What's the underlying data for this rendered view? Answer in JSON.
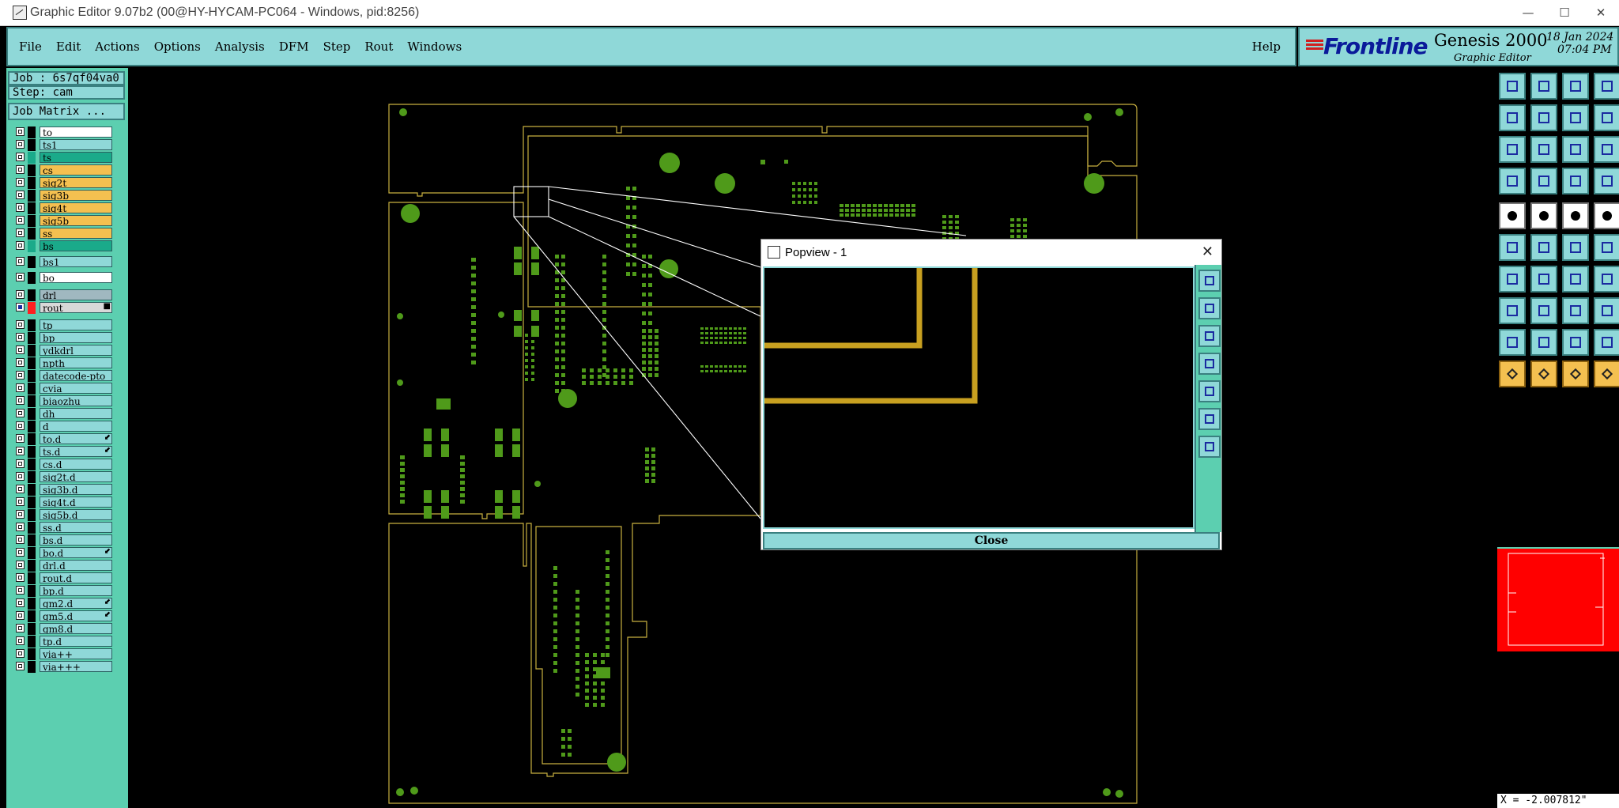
{
  "window": {
    "title": "Graphic Editor 9.07b2 (00@HY-HYCAM-PC064 - Windows, pid:8256)"
  },
  "menu": {
    "items": [
      "File",
      "Edit",
      "Actions",
      "Options",
      "Analysis",
      "DFM",
      "Step",
      "Rout",
      "Windows"
    ],
    "help": "Help"
  },
  "brand": {
    "logo": "Frontline",
    "product": "Genesis 2000",
    "subtitle": "Graphic Editor",
    "date": "18 Jan 2024",
    "time": "07:04 PM"
  },
  "job": {
    "job_label": "Job : 6s7qf04va0",
    "step_label": "Step: cam",
    "matrix_button": "Job Matrix ..."
  },
  "layers": [
    {
      "name": "to",
      "color": "#ffffff",
      "swatch": "#000000",
      "marked": false,
      "selected": false
    },
    {
      "name": "ts1",
      "color": "#8fd8d8",
      "swatch": "#000000",
      "marked": false,
      "selected": false
    },
    {
      "name": "ts",
      "color": "#1aaa8a",
      "swatch": "#1aaa8a",
      "marked": false,
      "selected": false
    },
    {
      "name": "cs",
      "color": "#f4c050",
      "swatch": "#000000",
      "marked": false,
      "selected": false
    },
    {
      "name": "sig2t",
      "color": "#f4c050",
      "swatch": "#000000",
      "marked": false,
      "selected": false
    },
    {
      "name": "sig3b",
      "color": "#f4c050",
      "swatch": "#000000",
      "marked": false,
      "selected": false
    },
    {
      "name": "sig4t",
      "color": "#f4c050",
      "swatch": "#000000",
      "marked": false,
      "selected": false
    },
    {
      "name": "sig5b",
      "color": "#f4c050",
      "swatch": "#000000",
      "marked": false,
      "selected": false
    },
    {
      "name": "ss",
      "color": "#f4c050",
      "swatch": "#000000",
      "marked": false,
      "selected": false
    },
    {
      "name": "bs",
      "color": "#1aaa8a",
      "swatch": "#1aaa8a",
      "marked": false,
      "selected": false
    },
    {
      "name": "bs1",
      "color": "#8fd8d8",
      "swatch": "#000000",
      "marked": false,
      "selected": false
    },
    {
      "name": "bo",
      "color": "#ffffff",
      "swatch": "#000000",
      "marked": false,
      "selected": false
    },
    {
      "name": "drl",
      "color": "#a0b8c0",
      "swatch": "#000000",
      "marked": false,
      "selected": false
    },
    {
      "name": "rout",
      "color": "#d8d8d8",
      "swatch": "#ff2020",
      "marked": true,
      "selected": true
    },
    {
      "name": "tp",
      "color": "#8fd8d8",
      "swatch": "#000000",
      "marked": false,
      "selected": false
    },
    {
      "name": "bp",
      "color": "#8fd8d8",
      "swatch": "#000000",
      "marked": false,
      "selected": false
    },
    {
      "name": "ydkdrl",
      "color": "#8fd8d8",
      "swatch": "#000000",
      "marked": false,
      "selected": false
    },
    {
      "name": "npth",
      "color": "#8fd8d8",
      "swatch": "#000000",
      "marked": false,
      "selected": false
    },
    {
      "name": "datecode-pto",
      "color": "#8fd8d8",
      "swatch": "#000000",
      "marked": false,
      "selected": false
    },
    {
      "name": "cvia",
      "color": "#8fd8d8",
      "swatch": "#000000",
      "marked": false,
      "selected": false
    },
    {
      "name": "biaozhu",
      "color": "#8fd8d8",
      "swatch": "#000000",
      "marked": false,
      "selected": false
    },
    {
      "name": "dh",
      "color": "#8fd8d8",
      "swatch": "#000000",
      "marked": false,
      "selected": false
    },
    {
      "name": "d",
      "color": "#8fd8d8",
      "swatch": "#000000",
      "marked": false,
      "selected": false
    },
    {
      "name": "to.d",
      "color": "#8fd8d8",
      "swatch": "#000000",
      "marked": true,
      "selected": false
    },
    {
      "name": "ts.d",
      "color": "#8fd8d8",
      "swatch": "#000000",
      "marked": true,
      "selected": false
    },
    {
      "name": "cs.d",
      "color": "#8fd8d8",
      "swatch": "#000000",
      "marked": false,
      "selected": false
    },
    {
      "name": "sig2t.d",
      "color": "#8fd8d8",
      "swatch": "#000000",
      "marked": false,
      "selected": false
    },
    {
      "name": "sig3b.d",
      "color": "#8fd8d8",
      "swatch": "#000000",
      "marked": false,
      "selected": false
    },
    {
      "name": "sig4t.d",
      "color": "#8fd8d8",
      "swatch": "#000000",
      "marked": false,
      "selected": false
    },
    {
      "name": "sig5b.d",
      "color": "#8fd8d8",
      "swatch": "#000000",
      "marked": false,
      "selected": false
    },
    {
      "name": "ss.d",
      "color": "#8fd8d8",
      "swatch": "#000000",
      "marked": false,
      "selected": false
    },
    {
      "name": "bs.d",
      "color": "#8fd8d8",
      "swatch": "#000000",
      "marked": false,
      "selected": false
    },
    {
      "name": "bo.d",
      "color": "#8fd8d8",
      "swatch": "#000000",
      "marked": true,
      "selected": false
    },
    {
      "name": "drl.d",
      "color": "#8fd8d8",
      "swatch": "#000000",
      "marked": false,
      "selected": false
    },
    {
      "name": "rout.d",
      "color": "#8fd8d8",
      "swatch": "#000000",
      "marked": false,
      "selected": false
    },
    {
      "name": "bp.d",
      "color": "#8fd8d8",
      "swatch": "#000000",
      "marked": false,
      "selected": false
    },
    {
      "name": "gm2.d",
      "color": "#8fd8d8",
      "swatch": "#000000",
      "marked": true,
      "selected": false
    },
    {
      "name": "gm5.d",
      "color": "#8fd8d8",
      "swatch": "#000000",
      "marked": true,
      "selected": false
    },
    {
      "name": "gm8.d",
      "color": "#8fd8d8",
      "swatch": "#000000",
      "marked": false,
      "selected": false
    },
    {
      "name": "tp.d",
      "color": "#8fd8d8",
      "swatch": "#000000",
      "marked": false,
      "selected": false
    },
    {
      "name": "via++",
      "color": "#8fd8d8",
      "swatch": "#000000",
      "marked": false,
      "selected": false
    },
    {
      "name": "via+++",
      "color": "#8fd8d8",
      "swatch": "#000000",
      "marked": false,
      "selected": false
    }
  ],
  "popview": {
    "title": "Popview - 1",
    "close_label": "Close"
  },
  "status": {
    "coord": "X = -2.007812\""
  },
  "colors": {
    "panel": "#8fd8d8",
    "panel_dark": "#5ccfb0",
    "pad_green": "#4f9a1a",
    "outline": "#c8b040",
    "trace": "#c8a020",
    "overview_red": "#ff0000"
  }
}
